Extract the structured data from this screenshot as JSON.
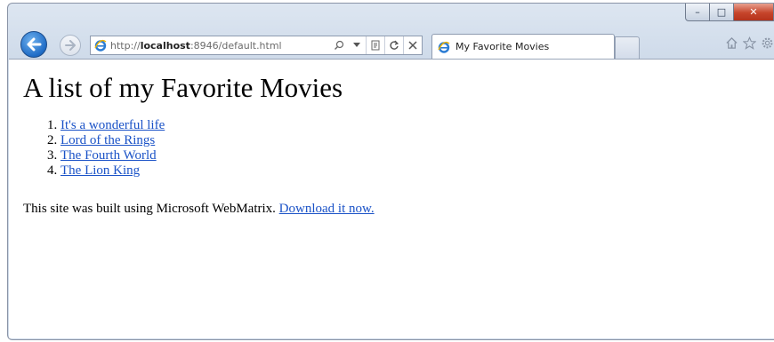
{
  "browser": {
    "address": {
      "prefix": "http://",
      "host": "localhost",
      "rest": ":8946/default.html"
    },
    "tab": {
      "title": "My Favorite Movies"
    },
    "icons": [
      "back-arrow-icon",
      "forward-arrow-icon",
      "ie-logo-icon",
      "search-icon",
      "dropdown-icon",
      "compat-view-icon",
      "refresh-icon",
      "stop-icon",
      "home-icon",
      "favorites-star-icon",
      "settings-gear-icon",
      "minimize-icon",
      "maximize-icon",
      "close-icon"
    ],
    "window_buttons": {
      "minimize": "–",
      "maximize": "□",
      "close": "✕"
    }
  },
  "page": {
    "heading": "A list of my Favorite Movies",
    "movies": [
      {
        "num": "1.",
        "title": "It's a wonderful life"
      },
      {
        "num": "2.",
        "title": "Lord of the Rings"
      },
      {
        "num": "3.",
        "title": "The Fourth World"
      },
      {
        "num": "4.",
        "title": "The Lion King"
      }
    ],
    "footer_text": "This site was built using Microsoft WebMatrix. ",
    "footer_link": "Download it now."
  },
  "colors": {
    "link": "#1a52c7",
    "back_button": "#1f6cc6",
    "close_button": "#c6452b"
  }
}
